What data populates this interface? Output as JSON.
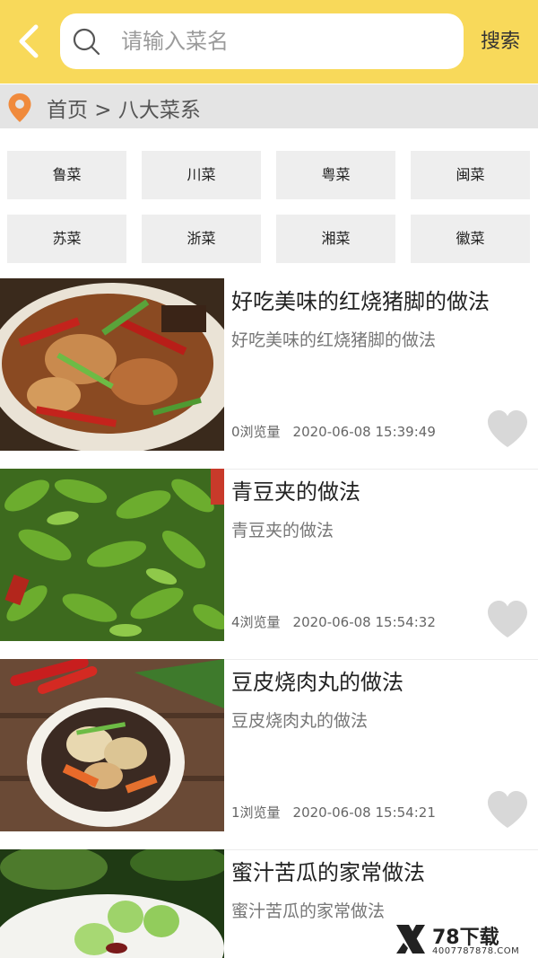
{
  "header": {
    "search_placeholder": "请输入菜名",
    "search_label": "搜索"
  },
  "breadcrumb": {
    "text": "首页 > 八大菜系"
  },
  "categories": [
    "鲁菜",
    "川菜",
    "粤菜",
    "闽菜",
    "苏菜",
    "浙菜",
    "湘菜",
    "徽菜"
  ],
  "recipes": [
    {
      "title": "好吃美味的红烧猪脚的做法",
      "desc": "好吃美味的红烧猪脚的做法",
      "views": "0浏览量",
      "date": "2020-06-08 15:39:49"
    },
    {
      "title": "青豆夹的做法",
      "desc": "青豆夹的做法",
      "views": "4浏览量",
      "date": "2020-06-08 15:54:32"
    },
    {
      "title": "豆皮烧肉丸的做法",
      "desc": "豆皮烧肉丸的做法",
      "views": "1浏览量",
      "date": "2020-06-08 15:54:21"
    },
    {
      "title": "蜜汁苦瓜的家常做法",
      "desc": "蜜汁苦瓜的家常做法"
    }
  ],
  "watermark": {
    "brand": "78下载",
    "url": "4007787878.COM"
  },
  "colors": {
    "header_bg": "#f8d95a",
    "pin": "#f08a3c",
    "heart": "#d8d8d8"
  }
}
